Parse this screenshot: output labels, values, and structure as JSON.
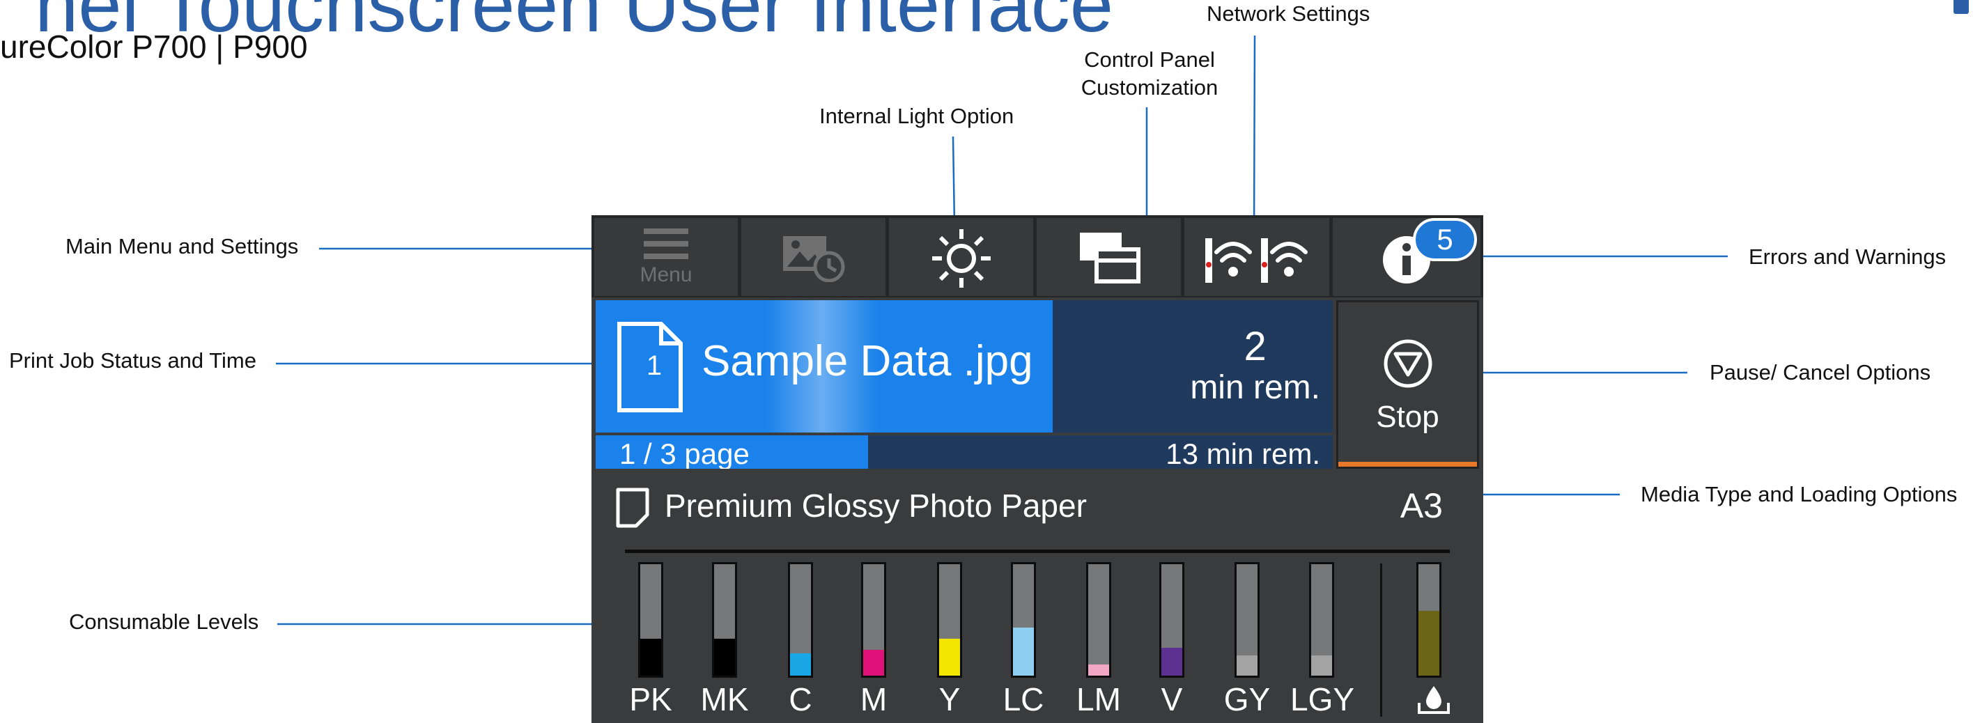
{
  "page": {
    "title": "nel Touchscreen User Interface",
    "subtitle": "ureColor P700 | P900"
  },
  "callouts": {
    "main_menu": "Main Menu and Settings",
    "print_job": "Print Job Status and Time",
    "consumables": "Consumable Levels",
    "internal_light": "Internal Light Option",
    "control_panel_line1": "Control Panel",
    "control_panel_line2": "Customization",
    "network": "Network Settings",
    "errors": "Errors and Warnings",
    "pause_cancel": "Pause/ Cancel Options",
    "media": "Media Type and Loading Options"
  },
  "panel": {
    "toolbar": {
      "menu_label": "Menu",
      "icons": [
        "menu-icon",
        "scheduled-print-icon",
        "light-icon",
        "panel-layout-icon",
        "wifi-icon",
        "info-icon"
      ],
      "info_badge": "5"
    },
    "job": {
      "copy_number": "1",
      "file_name": "Sample Data .jpg",
      "progress": 0.62,
      "minutes": "2",
      "minutes_unit": "min rem.",
      "page_label": "1 / 3  page",
      "page_progress": 0.37,
      "total_remaining": "13 min rem.",
      "stop_label": "Stop"
    },
    "media": {
      "type": "Premium Glossy Photo Paper",
      "size": "A3"
    },
    "inks": [
      {
        "label": "PK",
        "color": "#000000",
        "level": 0.33
      },
      {
        "label": "MK",
        "color": "#000000",
        "level": 0.33
      },
      {
        "label": "C",
        "color": "#1aa7e6",
        "level": 0.2
      },
      {
        "label": "M",
        "color": "#e0127a",
        "level": 0.23
      },
      {
        "label": "Y",
        "color": "#f2e600",
        "level": 0.33
      },
      {
        "label": "LC",
        "color": "#8fd0f2",
        "level": 0.43
      },
      {
        "label": "LM",
        "color": "#f2a7c4",
        "level": 0.1
      },
      {
        "label": "V",
        "color": "#5c3191",
        "level": 0.25
      },
      {
        "label": "GY",
        "color": "#a3a3a3",
        "level": 0.18
      },
      {
        "label": "LGY",
        "color": "#a3a3a3",
        "level": 0.18
      }
    ],
    "maintenance_box": {
      "color": "#6a6517",
      "level": 0.58
    }
  },
  "colors": {
    "heading": "#2b5fa8",
    "leader": "#1a6bc4",
    "panel_bg": "#3a3b3d",
    "progress": "#1a82ea",
    "progress_track": "#203a5e",
    "stop_accent": "#e8792b"
  }
}
